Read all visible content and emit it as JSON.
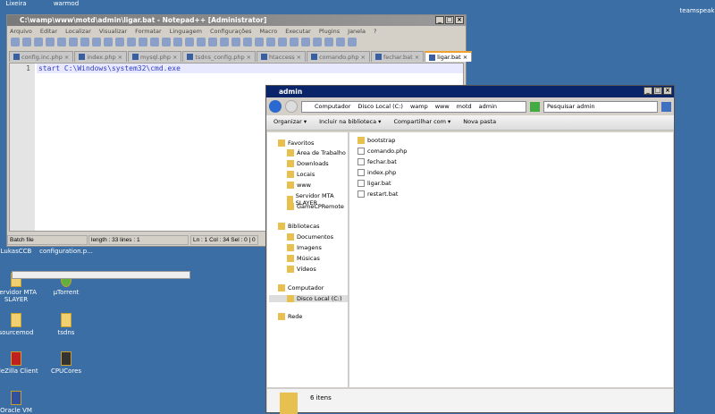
{
  "desktop": {
    "icons": [
      "Lixeira",
      "warmod",
      "teamspeak",
      "LukasCCB",
      "configuration.p...",
      "Servidor MTA SLAYER",
      "µTorrent",
      "sourcemod",
      "tsdns",
      "FileZilla Client",
      "CPUCores",
      "Oracle VM"
    ]
  },
  "notepad": {
    "title": "C:\\wamp\\www\\motd\\admin\\ligar.bat - Notepad++ [Administrator]",
    "menu": [
      "Arquivo",
      "Editar",
      "Localizar",
      "Visualizar",
      "Formatar",
      "Linguagem",
      "Configurações",
      "Macro",
      "Executar",
      "Plugins",
      "Janela",
      "?"
    ],
    "tabs": [
      "config.inc.php",
      "index.php",
      "mysql.php",
      "tsdns_config.php",
      "htaccess",
      "comando.php",
      "fechar.bat",
      "ligar.bat"
    ],
    "line_number": "1",
    "code": "start C:\\Windows\\system32\\cmd.exe",
    "status": {
      "type": "Batch file",
      "length": "length : 33    lines : 1",
      "pos": "Ln : 1    Col : 34    Sel : 0 | 0"
    }
  },
  "explorer": {
    "title": "admin",
    "breadcrumb": [
      "Computador",
      "Disco Local (C:)",
      "wamp",
      "www",
      "motd",
      "admin"
    ],
    "search_placeholder": "Pesquisar admin",
    "toolbar": [
      "Organizar ▾",
      "Incluir na biblioteca ▾",
      "Compartilhar com ▾",
      "Nova pasta"
    ],
    "nav": [
      "Favoritos",
      "Área de Trabalho",
      "Downloads",
      "Locais",
      "www",
      "Servidor MTA SLAYER",
      "GameCPRemote",
      "Bibliotecas",
      "Documentos",
      "Imagens",
      "Músicas",
      "Vídeos",
      "Computador",
      "Disco Local (C:)",
      "Rede"
    ],
    "files": [
      {
        "name": "bootstrap",
        "type": "folder"
      },
      {
        "name": "comando.php",
        "type": "file"
      },
      {
        "name": "fechar.bat",
        "type": "file"
      },
      {
        "name": "index.php",
        "type": "file"
      },
      {
        "name": "ligar.bat",
        "type": "file"
      },
      {
        "name": "restart.bat",
        "type": "file"
      }
    ],
    "item_count": "6 itens"
  }
}
